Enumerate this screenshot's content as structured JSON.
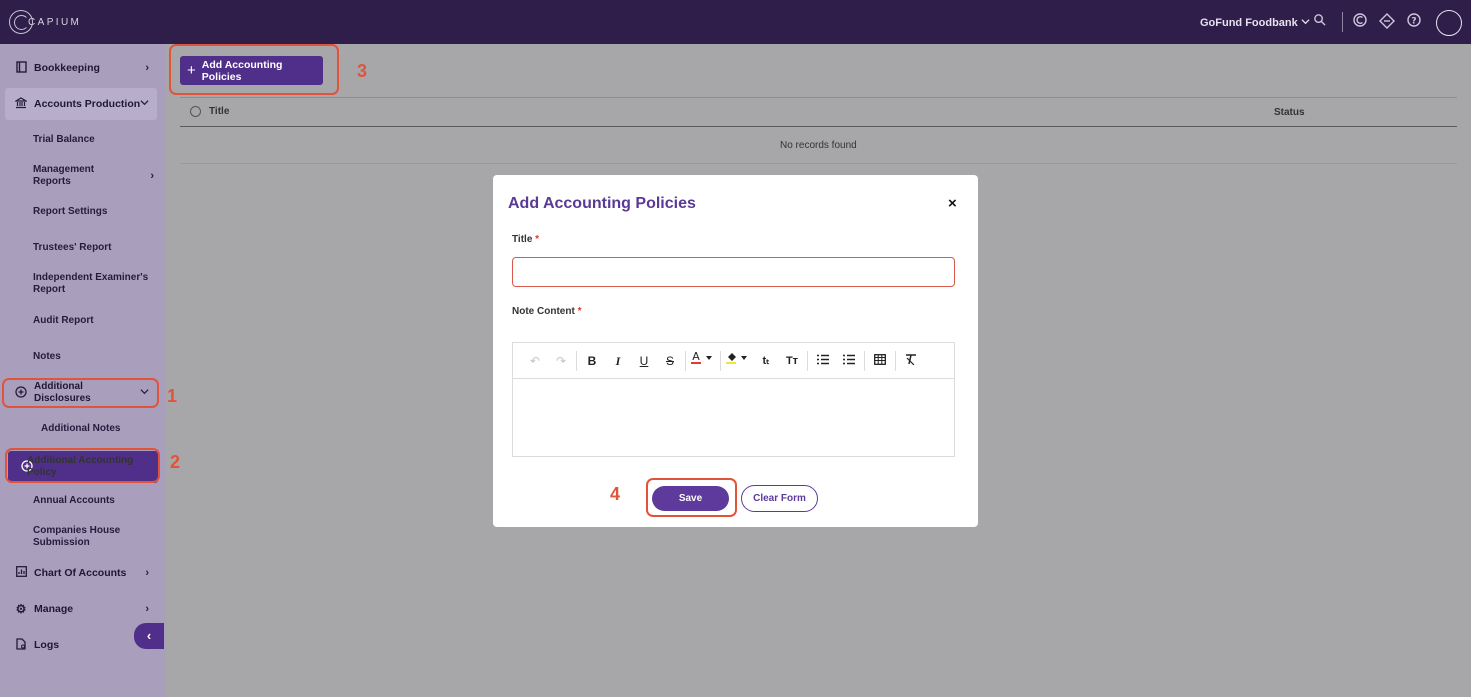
{
  "app": {
    "logo_text": "CAPIUM"
  },
  "header": {
    "org_name": "GoFund Foodbank",
    "icons": [
      "chevron-down-icon",
      "search-icon",
      "capium-c-icon",
      "diamond-tag-icon",
      "help-icon",
      "avatar"
    ]
  },
  "sidebar": {
    "items": [
      {
        "label": "Bookkeeping",
        "icon": "book-icon"
      },
      {
        "label": "Accounts Production",
        "icon": "bank-icon"
      },
      {
        "label": "Chart Of Accounts",
        "icon": "chart-icon"
      },
      {
        "label": "Manage",
        "icon": "gear-icon"
      },
      {
        "label": "Logs",
        "icon": "file-search-icon"
      }
    ],
    "sub_items": [
      "Trial Balance",
      "Management Reports",
      "Report Settings",
      "Trustees' Report",
      "Independent Examiner's Report",
      "Audit Report",
      "Notes",
      "Additional Disclosures",
      "Annual Accounts",
      "Companies House Submission"
    ],
    "nested_items": [
      "Additional Notes",
      "Additional Accounting Policy"
    ]
  },
  "main": {
    "add_button_label": "Add Accounting Policies",
    "table": {
      "columns": [
        "Title",
        "Status"
      ],
      "empty_text": "No records found"
    }
  },
  "modal": {
    "title": "Add Accounting Policies",
    "close_symbol": "×",
    "title_label": "Title",
    "content_label": "Note Content",
    "required_mark": "*",
    "title_value": "",
    "save_label": "Save",
    "clear_label": "Clear Form"
  },
  "annotations": {
    "step1": "1",
    "step2": "2",
    "step3": "3",
    "step4": "4"
  },
  "colors": {
    "topbar": "#2e1e49",
    "sidebar": "#a99fbd",
    "accent": "#4f2f8a",
    "highlight": "#e2533c"
  }
}
